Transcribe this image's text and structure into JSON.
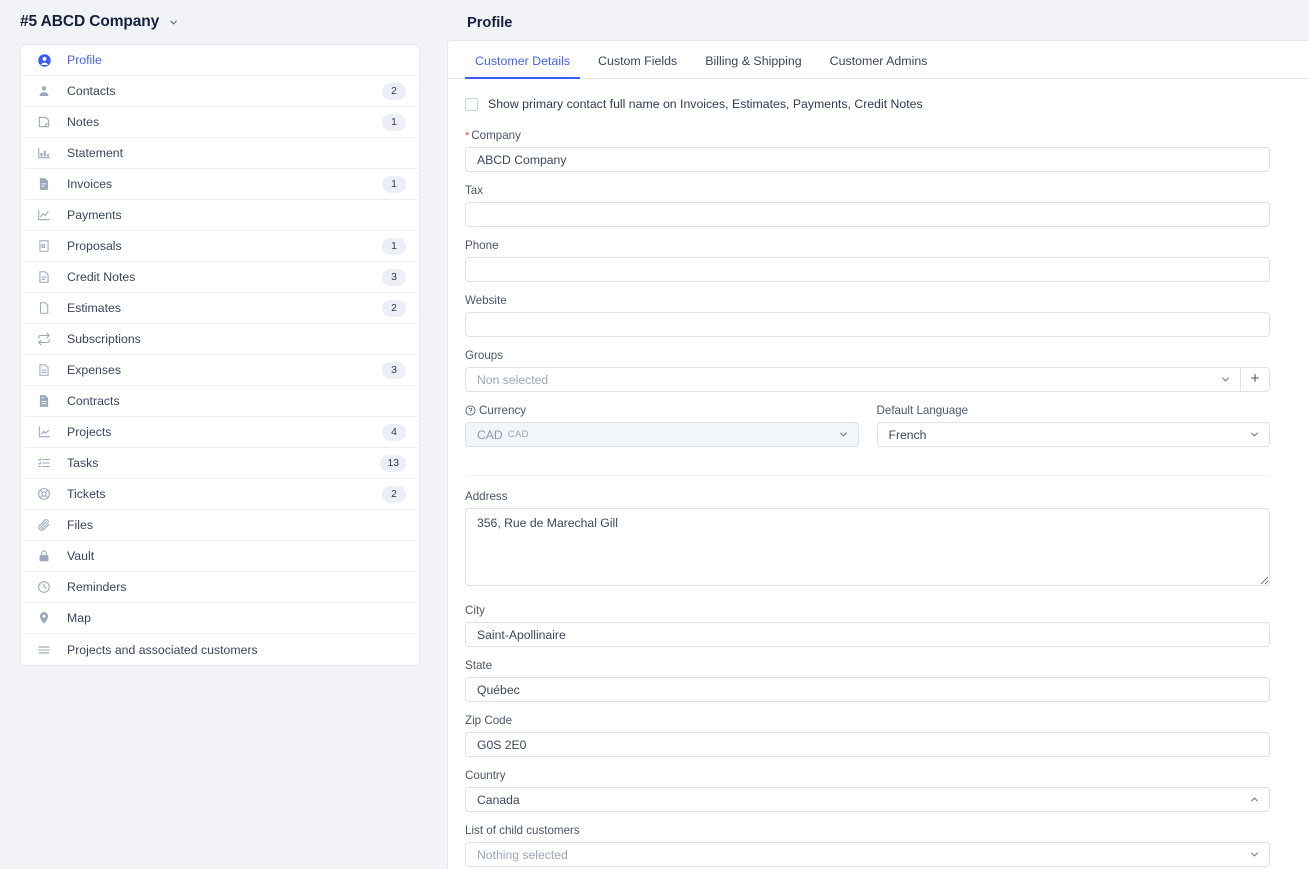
{
  "customer": {
    "header_title": "#5 ABCD Company",
    "header_caret_icon": "chevron-down-icon"
  },
  "sidebar": {
    "items": [
      {
        "label": "Profile",
        "icon": "user-circle-icon",
        "badge": "",
        "active": true
      },
      {
        "label": "Contacts",
        "icon": "user-icon",
        "badge": "2",
        "active": false
      },
      {
        "label": "Notes",
        "icon": "note-icon",
        "badge": "1",
        "active": false
      },
      {
        "label": "Statement",
        "icon": "chart-bar-icon",
        "badge": "",
        "active": false
      },
      {
        "label": "Invoices",
        "icon": "invoice-icon",
        "badge": "1",
        "active": false
      },
      {
        "label": "Payments",
        "icon": "chart-line-icon",
        "badge": "",
        "active": false
      },
      {
        "label": "Proposals",
        "icon": "proposal-icon",
        "badge": "1",
        "active": false
      },
      {
        "label": "Credit Notes",
        "icon": "credit-note-icon",
        "badge": "3",
        "active": false
      },
      {
        "label": "Estimates",
        "icon": "file-icon",
        "badge": "2",
        "active": false
      },
      {
        "label": "Subscriptions",
        "icon": "refresh-icon",
        "badge": "",
        "active": false
      },
      {
        "label": "Expenses",
        "icon": "expense-icon",
        "badge": "3",
        "active": false
      },
      {
        "label": "Contracts",
        "icon": "contract-icon",
        "badge": "",
        "active": false
      },
      {
        "label": "Projects",
        "icon": "project-chart-icon",
        "badge": "4",
        "active": false
      },
      {
        "label": "Tasks",
        "icon": "task-list-icon",
        "badge": "13",
        "active": false
      },
      {
        "label": "Tickets",
        "icon": "lifebuoy-icon",
        "badge": "2",
        "active": false
      },
      {
        "label": "Files",
        "icon": "paperclip-icon",
        "badge": "",
        "active": false
      },
      {
        "label": "Vault",
        "icon": "lock-icon",
        "badge": "",
        "active": false
      },
      {
        "label": "Reminders",
        "icon": "clock-icon",
        "badge": "",
        "active": false
      },
      {
        "label": "Map",
        "icon": "map-pin-icon",
        "badge": "",
        "active": false
      },
      {
        "label": "Projects and associated customers",
        "icon": "list-icon",
        "badge": "",
        "active": false
      }
    ]
  },
  "main": {
    "title": "Profile",
    "tabs": [
      {
        "label": "Customer Details",
        "active": true
      },
      {
        "label": "Custom Fields",
        "active": false
      },
      {
        "label": "Billing & Shipping",
        "active": false
      },
      {
        "label": "Customer Admins",
        "active": false
      }
    ]
  },
  "form": {
    "show_primary_contact_label": "Show primary contact full name on Invoices, Estimates, Payments, Credit Notes",
    "company": {
      "label": "Company",
      "required_marker": "*",
      "value": "ABCD Company"
    },
    "tax": {
      "label": "Tax",
      "value": ""
    },
    "phone": {
      "label": "Phone",
      "value": ""
    },
    "website": {
      "label": "Website",
      "value": ""
    },
    "groups": {
      "label": "Groups",
      "value": "Non selected",
      "add_icon": "plus-icon"
    },
    "currency": {
      "label": "Currency",
      "help_icon": "question-circle-icon",
      "value": "CAD",
      "sub_value": "CAD",
      "disabled": true
    },
    "default_language": {
      "label": "Default Language",
      "value": "French"
    },
    "address": {
      "label": "Address",
      "value": "356, Rue de Marechal Gill"
    },
    "city": {
      "label": "City",
      "value": "Saint-Apollinaire"
    },
    "state": {
      "label": "State",
      "value": "Québec"
    },
    "zip_code": {
      "label": "Zip Code",
      "value": "G0S 2E0"
    },
    "country": {
      "label": "Country",
      "value": "Canada",
      "chevron": "chevron-up-icon"
    },
    "child_customers": {
      "label": "List of child customers",
      "value": "Nothing selected"
    }
  },
  "colors": {
    "accent": "#3b5bf5",
    "accent_text": "#4361ee",
    "page_bg": "#f1f3f7",
    "card_bg": "#ffffff",
    "border": "#e3e8f0",
    "required": "#e0493c",
    "badge_bg": "#eceff6"
  }
}
